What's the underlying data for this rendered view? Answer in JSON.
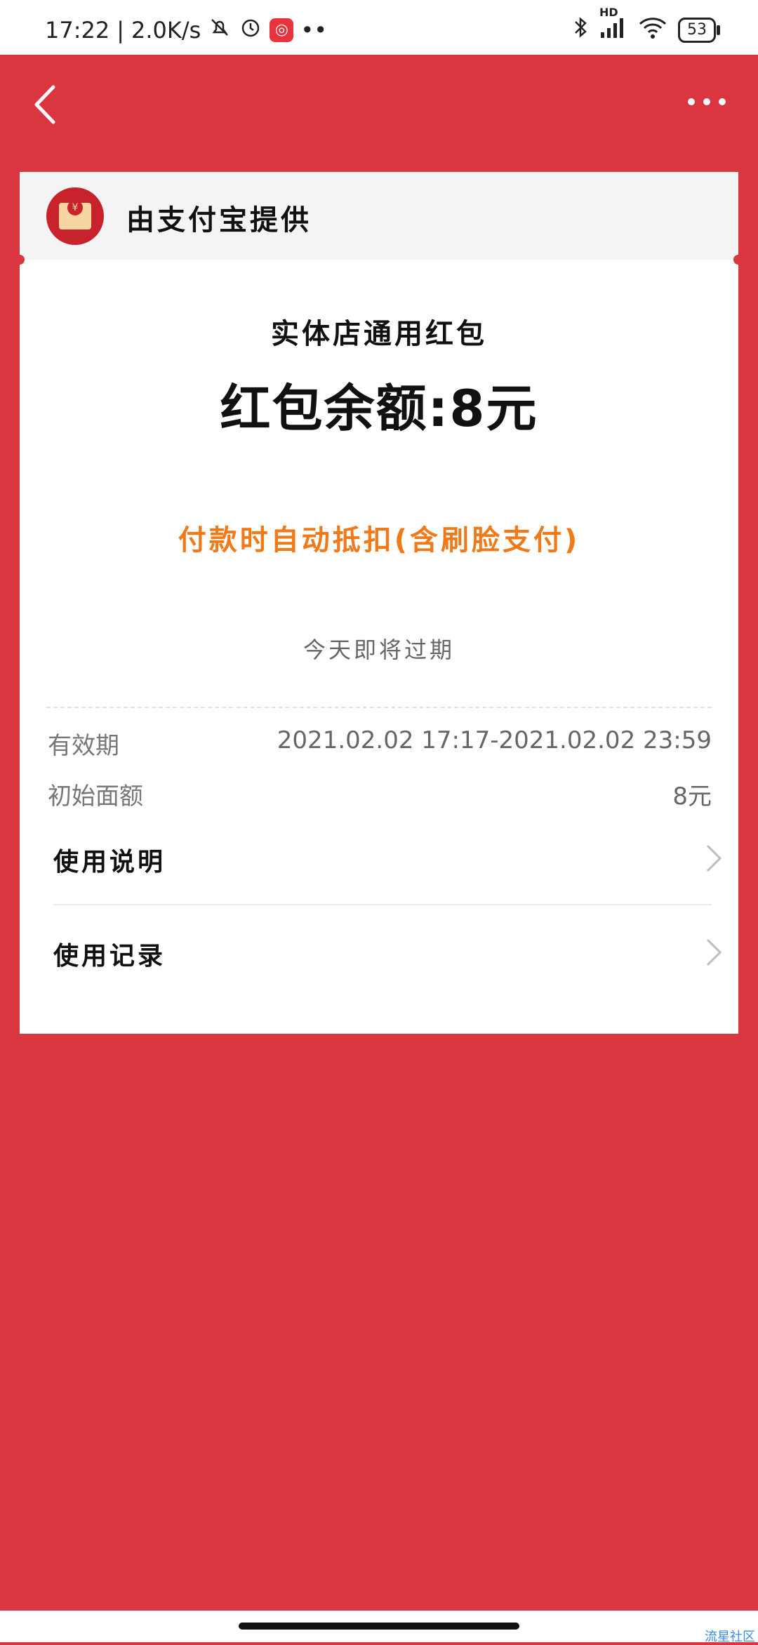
{
  "status_bar": {
    "time": "17:22",
    "speed": "2.0K/s",
    "battery": "53",
    "network_badge": "HD",
    "icons": [
      "mute-icon",
      "alarm-icon",
      "app-icon",
      "dots-icon",
      "bluetooth-icon",
      "signal-icon",
      "wifi-icon",
      "battery-icon"
    ]
  },
  "nav": {
    "back_icon": "chevron-left-icon",
    "more_icon": "ellipsis-icon"
  },
  "card": {
    "provider": "由支付宝提供",
    "title": "实体店通用红包",
    "balance": "红包余额:8元",
    "auto_deduct": "付款时自动抵扣(含刷脸支付)",
    "expire_note": "今天即将过期",
    "validity_label": "有效期",
    "validity_value": "2021.02.02 17:17-2021.02.02 23:59",
    "initial_label": "初始面额",
    "initial_value": "8元",
    "menu": [
      {
        "label": "使用说明"
      },
      {
        "label": "使用记录"
      }
    ]
  },
  "watermark": "流星社区",
  "colors": {
    "background": "#d93640",
    "accent_orange": "#f07a1a"
  }
}
